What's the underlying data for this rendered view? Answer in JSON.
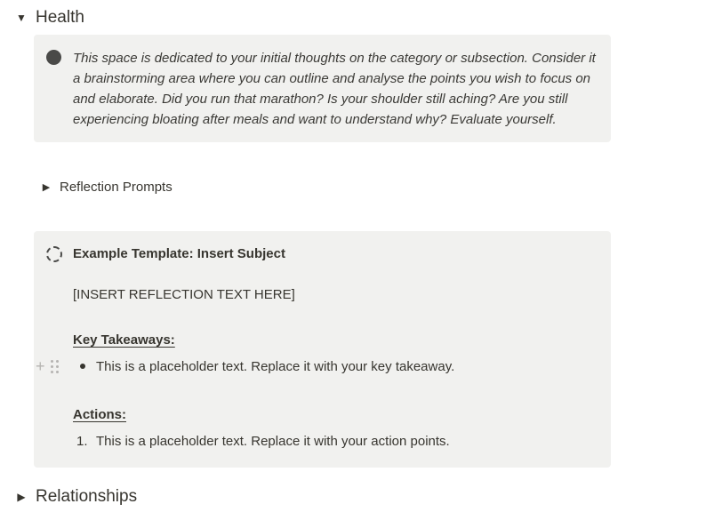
{
  "health": {
    "arrow": "▼",
    "title": "Health"
  },
  "intro_callout": {
    "text": "This space is dedicated to your initial thoughts on the category or subsection. Consider it a brainstorming area where you can outline and analyse the points you wish to focus on and elaborate. Did you run that marathon? Is your shoulder still aching? Are you still experiencing bloating after meals and want to understand why? Evaluate yourself."
  },
  "reflection_prompts": {
    "arrow": "▶",
    "label": "Reflection Prompts"
  },
  "template": {
    "title": "Example Template: Insert Subject",
    "reflection_text": "[INSERT REFLECTION TEXT HERE]",
    "takeaways_label": "Key Takeaways:",
    "takeaway_item": "This is a placeholder text. Replace it with your key takeaway.",
    "actions_label": "Actions:",
    "action_number": "1.",
    "action_item": "This is a placeholder text. Replace it with your action points."
  },
  "relationships": {
    "arrow": "▶",
    "title": "Relationships"
  },
  "icons": {
    "health_toggle": "triangle-down-icon",
    "prompts_toggle": "triangle-right-icon",
    "relationships_toggle": "triangle-right-icon",
    "intro_icon": "filled-circle-icon",
    "template_icon": "dashed-circle-icon",
    "add_block": "plus-icon",
    "drag_handle": "grip-icon"
  },
  "colors": {
    "callout_background": "#f1f1ef",
    "text": "#37352f",
    "muted_icon": "#b5b4b1"
  }
}
